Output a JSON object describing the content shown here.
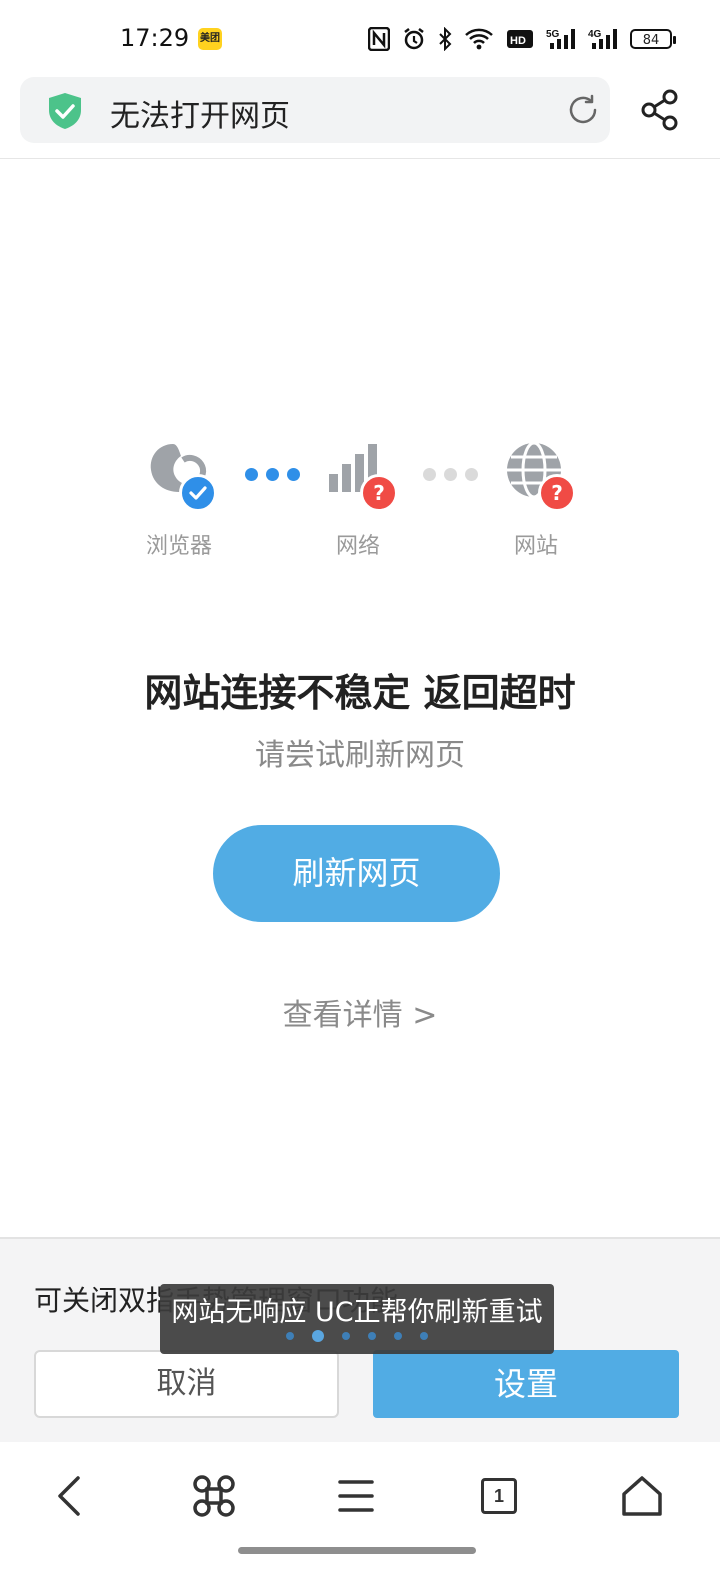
{
  "status_bar": {
    "time": "17:29",
    "app_badge": "美团",
    "battery": "84"
  },
  "address_bar": {
    "title": "无法打开网页"
  },
  "diagnostic": {
    "items": [
      {
        "label": "浏览器",
        "status": "ok"
      },
      {
        "label": "网络",
        "status": "unknown"
      },
      {
        "label": "网站",
        "status": "unknown"
      }
    ],
    "badge_ok_color": "#2F8FE8",
    "badge_error_color": "#F04B45"
  },
  "error": {
    "headline": "网站连接不稳定 返回超时",
    "subline": "请尝试刷新网页",
    "refresh_label": "刷新网页",
    "details_label": "查看详情 >"
  },
  "panel": {
    "message": "可关闭双指手势管理窗口功能",
    "cancel_label": "取消",
    "settings_label": "设置"
  },
  "toast": {
    "text": "网站无响应 UC正帮你刷新重试"
  },
  "bottom_nav": {
    "tab_count": "1"
  },
  "colors": {
    "accent": "#51ACE4",
    "shield": "#4CC38A"
  }
}
